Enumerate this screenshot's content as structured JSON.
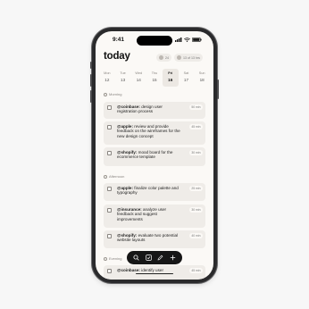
{
  "status": {
    "time": "9:41"
  },
  "header": {
    "title": "today",
    "streak": "24",
    "progress": "13 of 13 hrs"
  },
  "week": [
    {
      "name": "Mon",
      "date": "12"
    },
    {
      "name": "Tue",
      "date": "13"
    },
    {
      "name": "Wed",
      "date": "14"
    },
    {
      "name": "Thu",
      "date": "15"
    },
    {
      "name": "Fri",
      "date": "16",
      "selected": true
    },
    {
      "name": "Sat",
      "date": "17"
    },
    {
      "name": "Sun",
      "date": "18"
    }
  ],
  "sections": {
    "morning": "Morning",
    "afternoon": "Afternoon",
    "evening": "Evening"
  },
  "tasks": [
    {
      "handle": "@coinbase:",
      "text": " design user registration process",
      "duration": "50 min"
    },
    {
      "handle": "@apple:",
      "text": " review and provide feedback on the wireframes for the new design concept",
      "duration": "45 min"
    },
    {
      "handle": "@shopify:",
      "text": " mood board for the ecommerce template",
      "duration": "30 min"
    },
    {
      "handle": "@apple:",
      "text": " finalize color palette and typography",
      "duration": "25 min"
    },
    {
      "handle": "@insurance:",
      "text": " analyze user feedback and suggest improvements",
      "duration": "30 min"
    },
    {
      "handle": "@shopify:",
      "text": " evaluate two potential website layouts",
      "duration": "40 min"
    },
    {
      "handle": "@coinbase:",
      "text": " identify user",
      "duration": "45 min"
    }
  ],
  "toolbar": [
    "search-icon",
    "checklist-icon",
    "pencil-icon",
    "plus-icon"
  ],
  "colors": {
    "background": "#fbf9f6",
    "card": "#efece8",
    "toolbar": "#161616"
  }
}
